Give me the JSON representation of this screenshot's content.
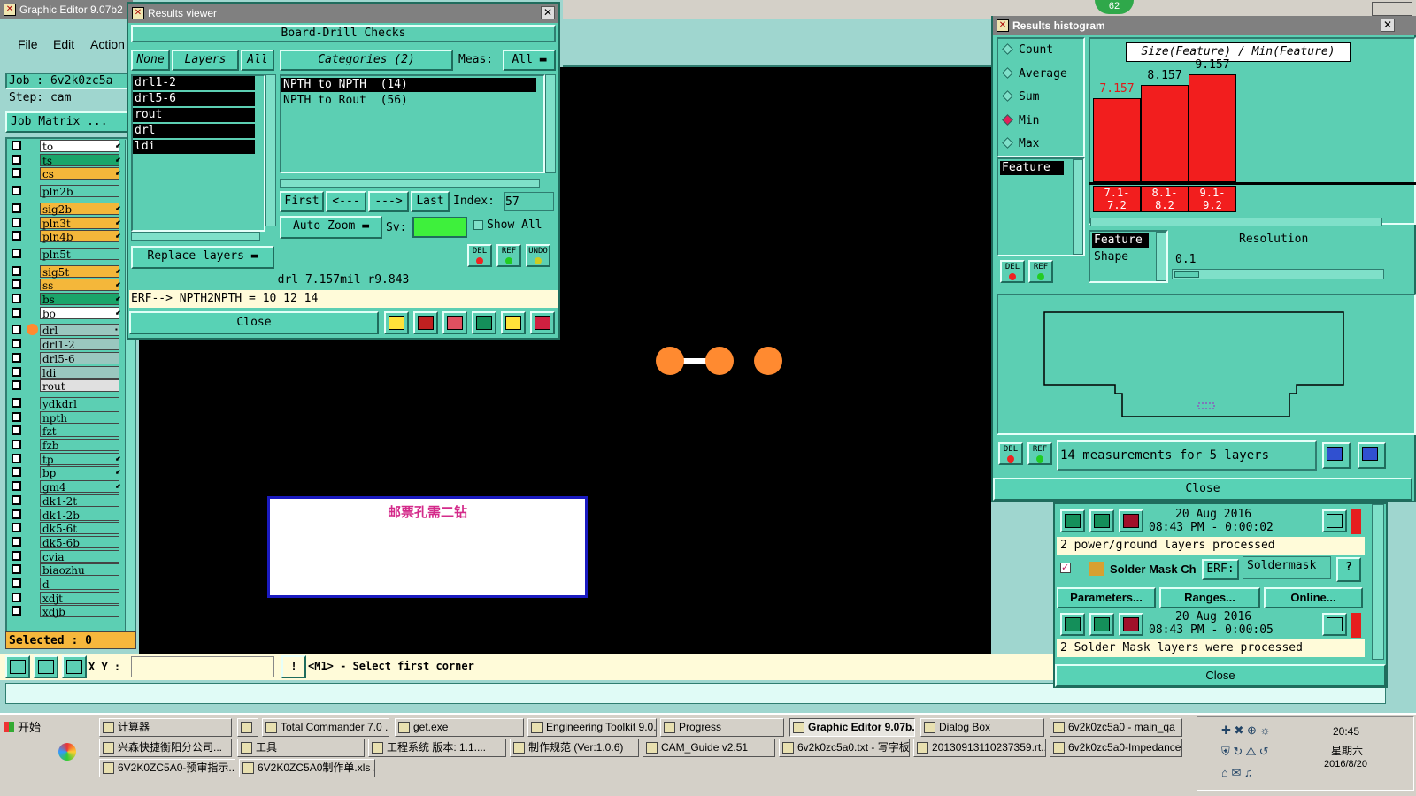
{
  "main_window": {
    "title": "Graphic Editor 9.07b2",
    "menu": [
      "File",
      "Edit",
      "Action"
    ],
    "job": "Job : 6v2k0zc5a",
    "step": "Step: cam",
    "job_matrix": "Job Matrix ...",
    "selected": "Selected : 0",
    "xy_label": "X Y :",
    "status_prompt": "<M1> - Select first corner",
    "canvas_text": "邮票孔需二钻"
  },
  "layers": [
    {
      "name": "to",
      "color": "#ffffff",
      "flag": "⬋"
    },
    {
      "name": "ts",
      "color": "#1aa56a",
      "flag": "⬋"
    },
    {
      "name": "cs",
      "color": "#f4b73a",
      "flag": "⬋"
    },
    {
      "name": "pln2b",
      "color": "#5ccfb3",
      "flag": ""
    },
    {
      "name": "sig2b",
      "color": "#f4b73a",
      "flag": "⬋"
    },
    {
      "name": "pln3t",
      "color": "#f4b73a",
      "flag": "⬋"
    },
    {
      "name": "pln4b",
      "color": "#f4b73a",
      "flag": "⬋"
    },
    {
      "name": "pln5t",
      "color": "#5ccfb3",
      "flag": ""
    },
    {
      "name": "sig5t",
      "color": "#f4b73a",
      "flag": "⬋"
    },
    {
      "name": "ss",
      "color": "#f4b73a",
      "flag": "⬋"
    },
    {
      "name": "bs",
      "color": "#1aa56a",
      "flag": "⬋"
    },
    {
      "name": "bo",
      "color": "#ffffff",
      "flag": "⬋"
    },
    {
      "name": "drl",
      "color": "#9ac7bf",
      "flag": "▪"
    },
    {
      "name": "drl1-2",
      "color": "#9ac7bf",
      "flag": ""
    },
    {
      "name": "drl5-6",
      "color": "#9ac7bf",
      "flag": ""
    },
    {
      "name": "ldi",
      "color": "#9ac7bf",
      "flag": ""
    },
    {
      "name": "rout",
      "color": "#e0e0e0",
      "flag": ""
    },
    {
      "name": "ydkdrl",
      "color": "#5ccfb3",
      "flag": ""
    },
    {
      "name": "npth",
      "color": "#5ccfb3",
      "flag": ""
    },
    {
      "name": "fzt",
      "color": "#5ccfb3",
      "flag": ""
    },
    {
      "name": "fzb",
      "color": "#5ccfb3",
      "flag": ""
    },
    {
      "name": "tp",
      "color": "#5ccfb3",
      "flag": "⬋"
    },
    {
      "name": "bp",
      "color": "#5ccfb3",
      "flag": "⬋"
    },
    {
      "name": "gm4",
      "color": "#5ccfb3",
      "flag": "⬋"
    },
    {
      "name": "dk1-2t",
      "color": "#5ccfb3",
      "flag": ""
    },
    {
      "name": "dk1-2b",
      "color": "#5ccfb3",
      "flag": ""
    },
    {
      "name": "dk5-6t",
      "color": "#5ccfb3",
      "flag": ""
    },
    {
      "name": "dk5-6b",
      "color": "#5ccfb3",
      "flag": ""
    },
    {
      "name": "cvia",
      "color": "#5ccfb3",
      "flag": ""
    },
    {
      "name": "biaozhu",
      "color": "#5ccfb3",
      "flag": ""
    },
    {
      "name": "d",
      "color": "#5ccfb3",
      "flag": ""
    },
    {
      "name": "xdjt",
      "color": "#5ccfb3",
      "flag": ""
    },
    {
      "name": "xdjb",
      "color": "#5ccfb3",
      "flag": ""
    }
  ],
  "results_viewer": {
    "title": "Results viewer",
    "header": "Board-Drill Checks",
    "none": "None",
    "layers_lbl": "Layers",
    "all": "All",
    "categories": "Categories (2)",
    "meas": "Meas:",
    "meas_val": "All",
    "layer_list": [
      "drl1-2",
      "drl5-6",
      "rout",
      "drl",
      "ldi"
    ],
    "category_list": [
      "NPTH to NPTH  (14)",
      "NPTH to Rout  (56)"
    ],
    "first": "First",
    "prev": "<---",
    "next": "--->",
    "last": "Last",
    "index_lbl": "Index:",
    "index_val": "57",
    "auto_zoom": "Auto Zoom",
    "sv": "Sv:",
    "show_all": "Show All",
    "replace_layers": "Replace layers",
    "info": "drl 7.157mil  r9.843",
    "erf": "ERF--> NPTH2NPTH = 10 12 14",
    "close": "Close"
  },
  "histogram": {
    "title": "Results histogram",
    "badge": "62",
    "options": [
      {
        "label": "Count",
        "on": false
      },
      {
        "label": "Average",
        "on": false
      },
      {
        "label": "Sum",
        "on": false
      },
      {
        "label": "Min",
        "on": true
      },
      {
        "label": "Max",
        "on": false
      }
    ],
    "formula": "Size(Feature) / Min(Feature)",
    "bars": [
      {
        "value": "7.157",
        "frac": 0.78
      },
      {
        "value": "8.157",
        "frac": 0.9
      },
      {
        "value": "9.157",
        "frac": 1.0
      }
    ],
    "bins": [
      [
        "7.1-",
        "7.2"
      ],
      [
        "8.1-",
        "8.2"
      ],
      [
        "9.1-",
        "9.2"
      ]
    ],
    "feature": "Feature",
    "feature2": "Feature",
    "shape": "Shape",
    "resolution": "Resolution",
    "res_val": "0.1",
    "measurements": "14 measurements for 5 layers",
    "close": "Close"
  },
  "checklist": {
    "date": "20 Aug 2016",
    "time1": "08:43 PM - 0:00:02",
    "msg1": "2 power/ground layers processed",
    "solder": "Solder Mask Ch",
    "erf": "ERF:",
    "erf_val": "Soldermask",
    "q": "?",
    "params": "Parameters...",
    "ranges": "Ranges...",
    "online": "Online...",
    "time2": "08:43 PM - 0:00:05",
    "msg2": "2 Solder Mask layers were processed",
    "close": "Close"
  },
  "taskbar": {
    "start": "开始",
    "row1": [
      "计算器",
      "",
      "Total Commander 7.0 ...",
      "get.exe",
      "Engineering Toolkit 9.0...",
      "Progress",
      "Graphic Editor 9.07b...",
      "Dialog Box",
      "6v2k0zc5a0 - main_qa"
    ],
    "row2": [
      "兴森快捷衡阳分公司...",
      "工具",
      "工程系统  版本: 1.1....",
      "制作规范 (Ver:1.0.6)",
      "CAM_Guide v2.51",
      "6v2k0zc5a0.txt - 写字板",
      "20130913110237359.rt...",
      "6v2k0zc5a0-Impedance..."
    ],
    "row3": [
      "6V2K0ZC5A0-预审指示...",
      "6V2K0ZC5A0制作单.xls ..."
    ],
    "time": "20:45",
    "day": "星期六",
    "date": "2016/8/20"
  }
}
